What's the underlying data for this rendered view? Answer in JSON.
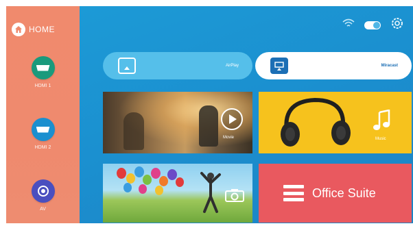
{
  "sidebar": {
    "home_label": "HOME",
    "sources": [
      {
        "label": "HDMI 1",
        "icon": "hdmi-port-icon",
        "color": "#1a9a7c"
      },
      {
        "label": "HDMI 2",
        "icon": "hdmi-port-icon",
        "color": "#1b8fcf"
      },
      {
        "label": "AV",
        "icon": "av-port-icon",
        "color": "#4a4fbf"
      }
    ]
  },
  "status": {
    "wifi_icon": "wifi-icon",
    "toggle_icon": "toggle-switch",
    "settings_icon": "gear-icon"
  },
  "pills": {
    "left_label": "AirPlay",
    "right_label": "Miracast"
  },
  "tiles": {
    "movie_label": "Movie",
    "music_label": "Music",
    "office_label": "Office Suite"
  },
  "colors": {
    "sidebar": "#f08a6d",
    "main": "#1c9ad6",
    "music": "#f6c21d",
    "office": "#e9595f"
  }
}
